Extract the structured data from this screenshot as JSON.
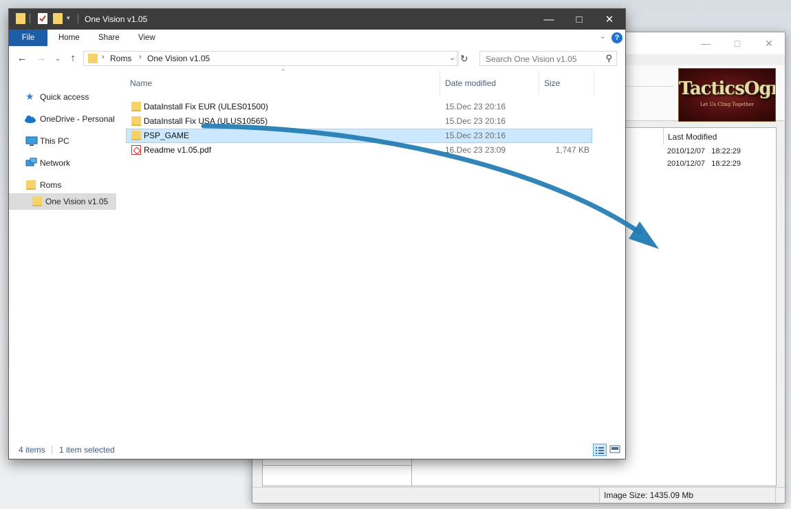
{
  "back_window": {
    "column_header": "Last Modified",
    "rows": [
      "2010/12/07   18:22:29",
      "2010/12/07   18:22:29"
    ],
    "logo_text": "TacticsOgre",
    "logo_subtitle": "Let Us Cling Together",
    "status_text": "Image Size: 1435.09 Mb"
  },
  "explorer": {
    "title": "One Vision v1.05",
    "ribbon_tabs": [
      "File",
      "Home",
      "Share",
      "View"
    ],
    "breadcrumb": [
      "Roms",
      "One Vision v1.05"
    ],
    "search_placeholder": "Search One Vision v1.05",
    "nav_items": [
      {
        "label": "Quick access",
        "icon": "star-icon"
      },
      {
        "label": "OneDrive - Personal",
        "icon": "cloud-icon"
      },
      {
        "label": "This PC",
        "icon": "computer-icon"
      },
      {
        "label": "Network",
        "icon": "network-icon"
      },
      {
        "label": "Roms",
        "icon": "folder-icon"
      },
      {
        "label": "One Vision v1.05",
        "icon": "folder-icon"
      }
    ],
    "columns": [
      "Name",
      "Date modified",
      "Size"
    ],
    "files": [
      {
        "name": "DataInstall Fix EUR (ULES01500)",
        "date": "15.Dec 23 20:16",
        "size": "",
        "type": "folder"
      },
      {
        "name": "DataInstall Fix USA (ULUS10565)",
        "date": "15.Dec 23 20:16",
        "size": "",
        "type": "folder"
      },
      {
        "name": "PSP_GAME",
        "date": "15.Dec 23 20:16",
        "size": "",
        "type": "folder"
      },
      {
        "name": "Readme v1.05.pdf",
        "date": "16.Dec 23 23:09",
        "size": "1,747 KB",
        "type": "pdf"
      }
    ],
    "status_items": "4 items",
    "status_selected": "1 item selected"
  },
  "colors": {
    "accent": "#1e5da8",
    "selection": "#cce8ff",
    "drag_arrow": "#1f7bb3",
    "folder": "#f6d36a"
  }
}
